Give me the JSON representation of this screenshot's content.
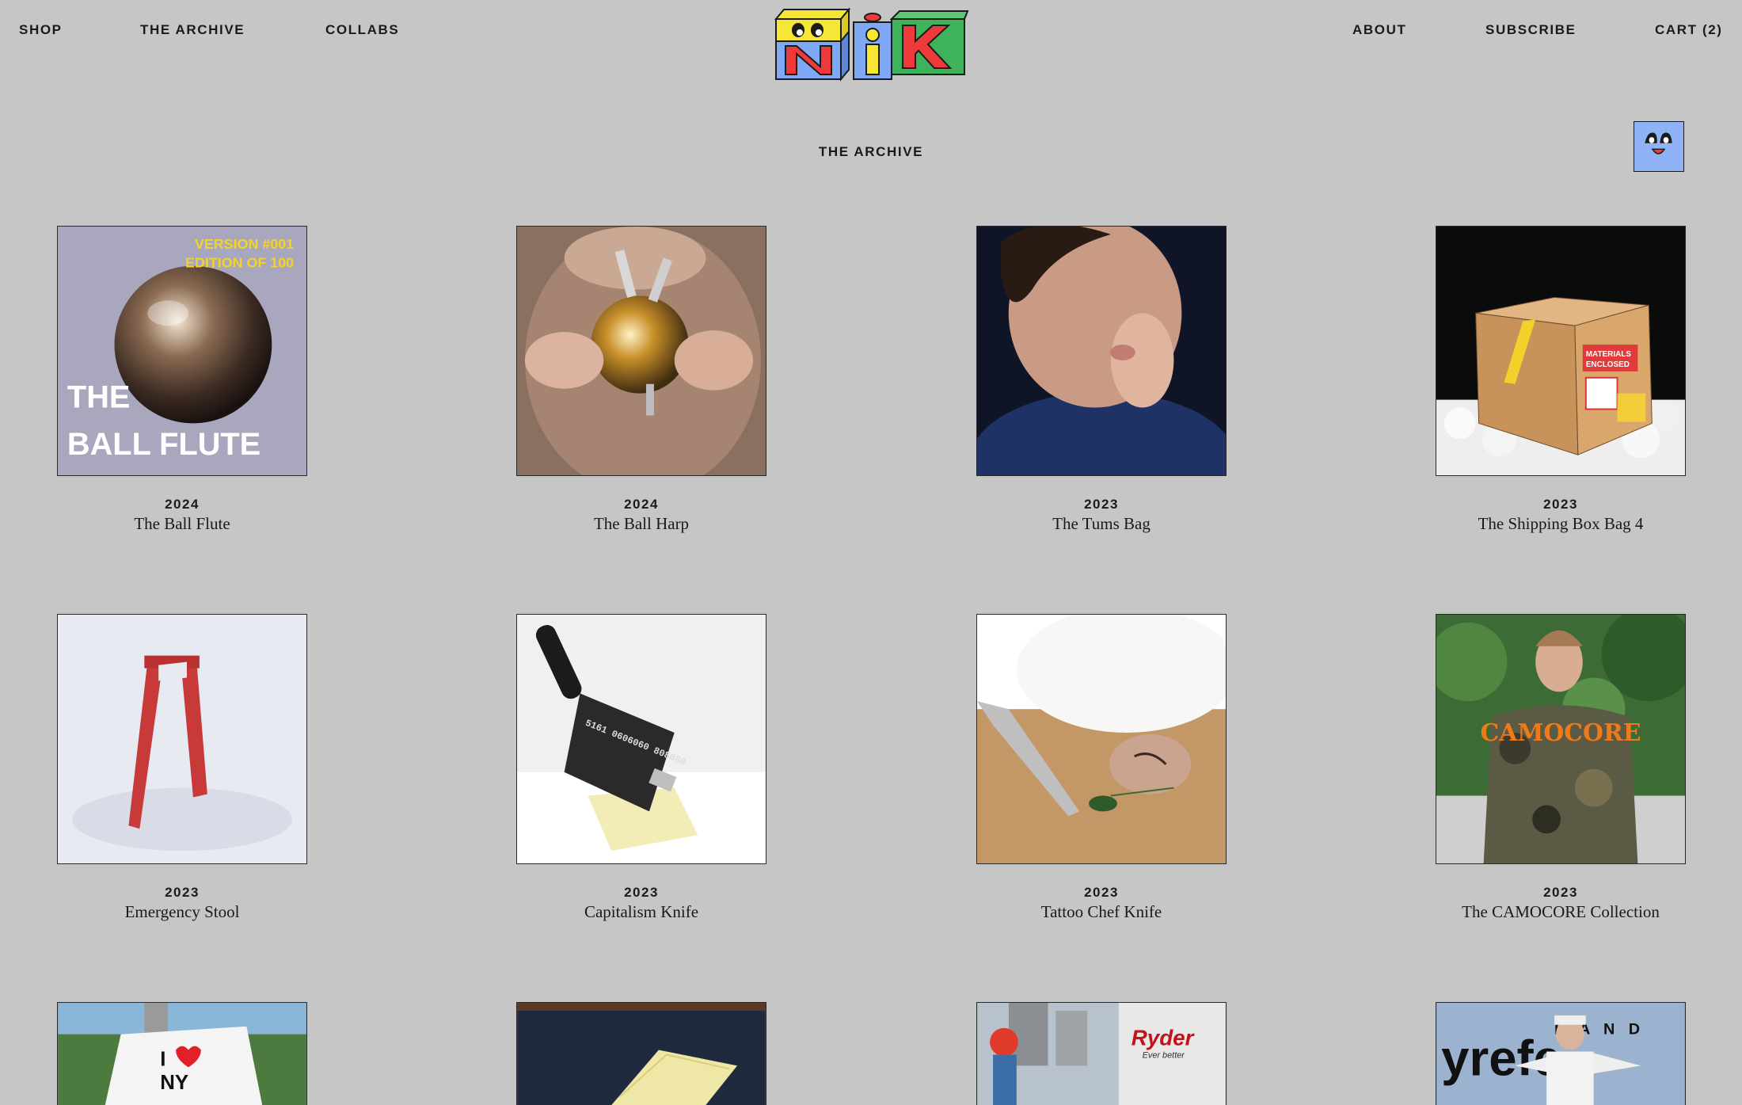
{
  "header": {
    "nav_left": [
      "SHOP",
      "THE ARCHIVE",
      "COLLABS"
    ],
    "nav_right": [
      "ABOUT",
      "SUBSCRIBE",
      "CART (2)"
    ],
    "logo_letters": "NiK"
  },
  "page": {
    "title": "THE ARCHIVE"
  },
  "items": [
    {
      "year": "2024",
      "name": "The Ball Flute",
      "thumb_text_1": "VERSION #001",
      "thumb_text_2": "EDITION OF 100",
      "thumb_text_3": "THE",
      "thumb_text_4": "BALL FLUTE"
    },
    {
      "year": "2024",
      "name": "The Ball Harp"
    },
    {
      "year": "2023",
      "name": "The Tums Bag"
    },
    {
      "year": "2023",
      "name": "The Shipping Box Bag 4",
      "thumb_text_1": "MATERIALS",
      "thumb_text_2": "ENCLOSED"
    },
    {
      "year": "2023",
      "name": "Emergency Stool"
    },
    {
      "year": "2023",
      "name": "Capitalism Knife",
      "thumb_text_1": "5161 0606060 808080"
    },
    {
      "year": "2023",
      "name": "Tattoo Chef Knife"
    },
    {
      "year": "2023",
      "name": "The CAMOCORE Collection",
      "thumb_text_1": "CAMOCORE"
    },
    {
      "year": "",
      "name": "",
      "thumb_text_1": "I",
      "thumb_text_2": "NY"
    },
    {
      "year": "",
      "name": ""
    },
    {
      "year": "",
      "name": "",
      "thumb_text_1": "Ryder",
      "thumb_text_2": "Ever better"
    },
    {
      "year": "",
      "name": "",
      "thumb_text_1": "yrefe",
      "thumb_text_2": "B A N D"
    }
  ],
  "colors": {
    "background": "#c6c6c6",
    "logo_yellow": "#f6e635",
    "logo_blue": "#7fa8f5",
    "logo_red": "#ee3a3a",
    "logo_green": "#3fb35b",
    "face_button": "#8fb3f6"
  },
  "icons": {
    "face_button": "smiley-face-icon"
  }
}
